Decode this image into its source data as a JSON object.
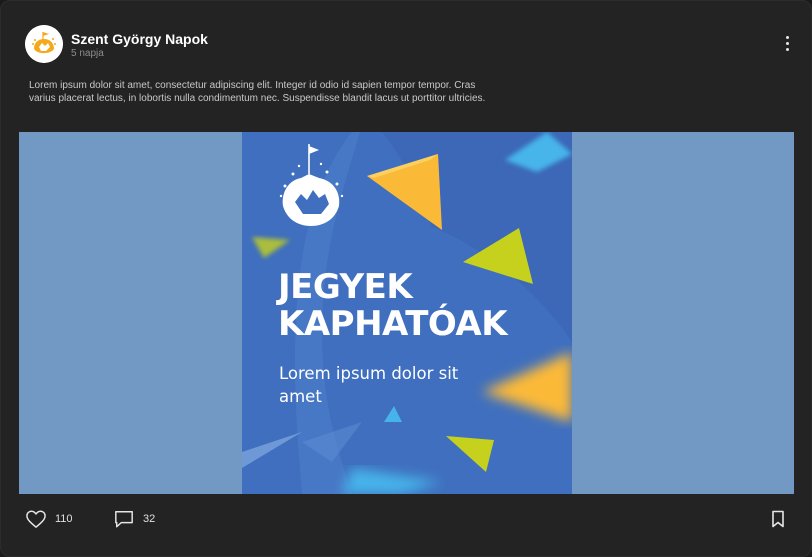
{
  "post": {
    "author": "Szent György Napok",
    "timestamp": "5 napja",
    "caption": "Lorem ipsum dolor sit amet, consectetur adipiscing elit. Integer id odio id sapien tempor tempor. Cras varius placerat lectus, in lobortis nulla condimentum nec. Suspendisse blandit lacus ut porttitor ultricies."
  },
  "poster": {
    "title_line1": "JEGYEK",
    "title_line2": "KAPHATÓAK",
    "subtitle": "Lorem ipsum dolor sit amet"
  },
  "actions": {
    "likes": "110",
    "comments": "32"
  },
  "icons": {
    "more": "more-vertical-icon",
    "like": "heart-icon",
    "comment": "comment-icon",
    "save": "bookmark-icon"
  },
  "colors": {
    "card_bg": "#232323",
    "poster_blue": "#3f6fbe",
    "media_bg": "#7299c4",
    "accent_yellow": "#fbb938",
    "accent_lime": "#c6d11e",
    "accent_cyan": "#46b4ea"
  }
}
